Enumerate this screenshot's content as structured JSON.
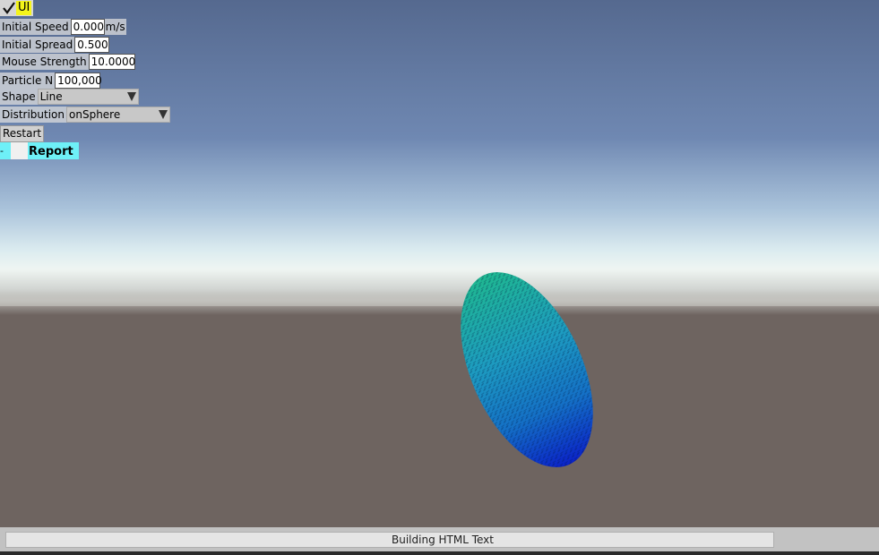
{
  "ui_toggle": {
    "label": "UI",
    "checked": true,
    "highlight_color": "#f4f41a"
  },
  "controls": {
    "initial_speed": {
      "label": "Initial Speed",
      "value": "0.000",
      "unit": "m/s"
    },
    "initial_spread": {
      "label": "Initial Spread",
      "value": "0.500"
    },
    "mouse_strength": {
      "label": "Mouse Strength",
      "value": "10.0000"
    },
    "particle_n": {
      "label": "Particle N",
      "value": "100,000"
    },
    "shape": {
      "label": "Shape",
      "selected": "Line"
    },
    "distribution": {
      "label": "Distribution",
      "selected": "onSphere"
    }
  },
  "buttons": {
    "restart": "Restart",
    "report_arrow": "->",
    "report": "Report",
    "report_color": "#6ef0f7"
  },
  "status": {
    "text": "Building HTML Text",
    "progress": 0.88
  },
  "scene": {
    "sky_color": "#6f88b2",
    "ground_color": "#6e6460",
    "particle_colors": [
      "#1fb891",
      "#1d8fc0",
      "#0a22c8"
    ]
  }
}
